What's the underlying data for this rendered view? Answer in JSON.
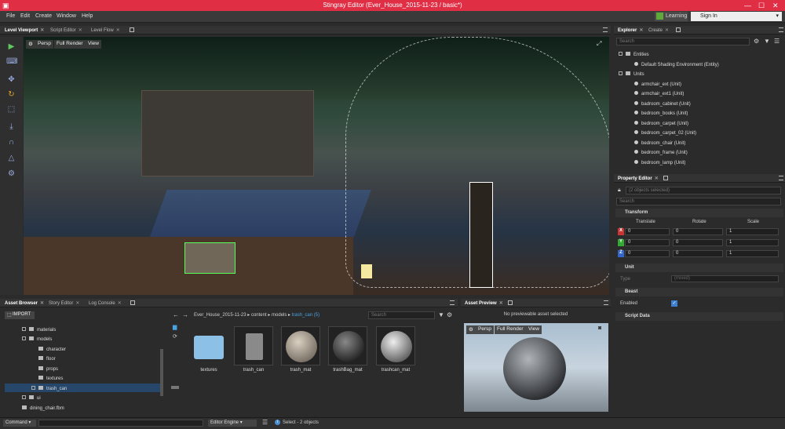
{
  "window": {
    "title": "Stingray Editor (Ever_House_2015-11-23 / basic*)"
  },
  "menu": [
    "File",
    "Edit",
    "Create",
    "Window",
    "Help"
  ],
  "header": {
    "learning_label": "Learning",
    "signin_label": "Sign In"
  },
  "viewport_tabs": [
    "Level Viewport",
    "Script Editor",
    "Level Flow"
  ],
  "viewport_toolbar": {
    "persp": "Persp",
    "render": "Full Render",
    "view": "View"
  },
  "explorer": {
    "tabs": [
      "Explorer",
      "Create"
    ],
    "search_placeholder": "Search",
    "entities_label": "Entities",
    "entity_item": "Default Shading Environment (Entity)",
    "units_label": "Units",
    "units": [
      "armchair_ext (Unit)",
      "armchair_ext1 (Unit)",
      "badroom_cabinet (Unit)",
      "bedroom_books (Unit)",
      "bedroom_carpet (Unit)",
      "bedroom_carpet_02 (Unit)",
      "bedroom_chair (Unit)",
      "bedroom_frame (Unit)",
      "bedroom_lamp (Unit)"
    ]
  },
  "property_editor": {
    "title": "Property Editor",
    "selected_info": "(2 objects selected)",
    "search_placeholder": "Search",
    "transform_label": "Transform",
    "col_translate": "Translate",
    "col_rotate": "Rotate",
    "col_scale": "Scale",
    "rows": [
      {
        "axis": "X",
        "translate": "0",
        "rotate": "0",
        "scale": "1"
      },
      {
        "axis": "Y",
        "translate": "0",
        "rotate": "0",
        "scale": "1"
      },
      {
        "axis": "Z",
        "translate": "0",
        "rotate": "0",
        "scale": "1"
      }
    ],
    "unit_label": "Unit",
    "type_label": "Type",
    "type_value": "(mixed)",
    "beast_label": "Beast",
    "enabled_label": "Enabled",
    "script_data_label": "Script Data"
  },
  "asset_browser": {
    "tabs": [
      "Asset Browser",
      "Story Editor",
      "Log Console"
    ],
    "import_label": "IMPORT",
    "breadcrumb": [
      "Ever_House_2015-11-23",
      "content",
      "models",
      "trash_can (5)"
    ],
    "search_placeholder": "Search",
    "tree": [
      "materials",
      "models",
      "character",
      "floor",
      "props",
      "textures",
      "trash_can",
      "ui",
      "dining_chair.fbm"
    ],
    "assets": [
      "textures",
      "trash_can",
      "trash_mat",
      "trashBag_mat",
      "trashcan_mat"
    ]
  },
  "asset_preview": {
    "title": "Asset Preview",
    "message": "No previewable asset selected",
    "persp": "Persp",
    "render": "Full Render",
    "view": "View"
  },
  "statusbar": {
    "command_label": "Command",
    "engine_label": "Editor Engine",
    "status_text": "Select - 2 objects"
  }
}
